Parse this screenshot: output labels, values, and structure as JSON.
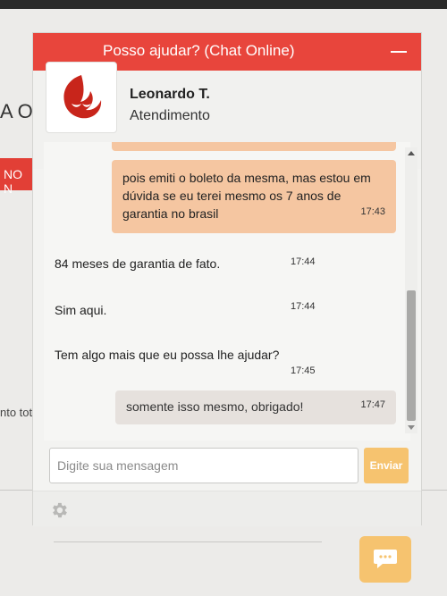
{
  "background": {
    "heading": "A O",
    "red_button": "NO N",
    "text": "nto tot"
  },
  "chat": {
    "title": "Posso ajudar? (Chat Online)",
    "agent_name": "Leonardo T.",
    "agent_role": "Atendimento",
    "messages": [
      {
        "from": "user",
        "text": "pois emiti o boleto da mesma, mas estou em dúvida se eu terei mesmo os 7 anos de garantia no brasil",
        "time": "17:43"
      },
      {
        "from": "agent",
        "text": "84 meses de garantia de fato.",
        "time": "17:44"
      },
      {
        "from": "agent",
        "text": "Sim aqui.",
        "time": "17:44"
      },
      {
        "from": "agent",
        "text": "Tem algo mais que eu possa lhe ajudar?",
        "time": "17:45"
      },
      {
        "from": "user",
        "text": "somente isso mesmo, obrigado!",
        "time": "17:47"
      }
    ],
    "input_placeholder": "Digite sua mensagem",
    "send_label": "Enviar"
  },
  "colors": {
    "header": "#e8453c",
    "user_bubble": "#f5c6a1",
    "accent": "#f6c36f"
  }
}
